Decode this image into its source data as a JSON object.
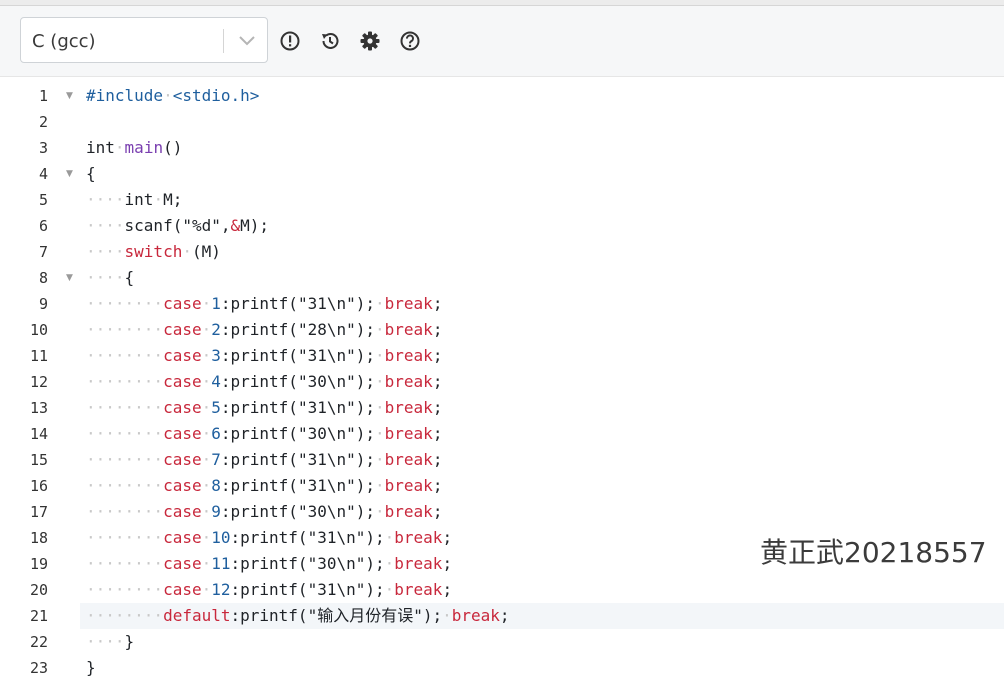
{
  "toolbar": {
    "language": "C (gcc)",
    "icons": [
      "alert-icon",
      "history-icon",
      "gear-icon",
      "help-icon"
    ]
  },
  "editor": {
    "active_line": 21,
    "lines": [
      {
        "n": "1",
        "fold": true,
        "tokens": [
          {
            "t": "#include",
            "c": "kw-blue"
          },
          {
            "t": "·",
            "c": "ws"
          },
          {
            "t": "<stdio.h>",
            "c": "kw-blue"
          }
        ]
      },
      {
        "n": "2",
        "fold": false,
        "tokens": []
      },
      {
        "n": "3",
        "fold": false,
        "tokens": [
          {
            "t": "int",
            "c": ""
          },
          {
            "t": "·",
            "c": "ws"
          },
          {
            "t": "main",
            "c": "kw-purple"
          },
          {
            "t": "()",
            "c": ""
          }
        ]
      },
      {
        "n": "4",
        "fold": true,
        "tokens": [
          {
            "t": "{",
            "c": ""
          }
        ]
      },
      {
        "n": "5",
        "fold": false,
        "tokens": [
          {
            "t": "····",
            "c": "ws"
          },
          {
            "t": "int",
            "c": ""
          },
          {
            "t": "·",
            "c": "ws"
          },
          {
            "t": "M;",
            "c": ""
          }
        ]
      },
      {
        "n": "6",
        "fold": false,
        "tokens": [
          {
            "t": "····",
            "c": "ws"
          },
          {
            "t": "scanf(\"%d\",",
            "c": ""
          },
          {
            "t": "&",
            "c": "kw-red"
          },
          {
            "t": "M);",
            "c": ""
          }
        ]
      },
      {
        "n": "7",
        "fold": false,
        "tokens": [
          {
            "t": "····",
            "c": "ws"
          },
          {
            "t": "switch",
            "c": "kw-red"
          },
          {
            "t": "·",
            "c": "ws"
          },
          {
            "t": "(M)",
            "c": ""
          }
        ]
      },
      {
        "n": "8",
        "fold": true,
        "tokens": [
          {
            "t": "····",
            "c": "ws"
          },
          {
            "t": "{",
            "c": ""
          }
        ]
      },
      {
        "n": "9",
        "fold": false,
        "tokens": [
          {
            "t": "········",
            "c": "ws"
          },
          {
            "t": "case",
            "c": "kw-red"
          },
          {
            "t": "·",
            "c": "ws"
          },
          {
            "t": "1",
            "c": "num"
          },
          {
            "t": ":printf(\"31\\n\");",
            "c": ""
          },
          {
            "t": "·",
            "c": "ws"
          },
          {
            "t": "break",
            "c": "kw-red"
          },
          {
            "t": ";",
            "c": ""
          }
        ]
      },
      {
        "n": "10",
        "fold": false,
        "tokens": [
          {
            "t": "········",
            "c": "ws"
          },
          {
            "t": "case",
            "c": "kw-red"
          },
          {
            "t": "·",
            "c": "ws"
          },
          {
            "t": "2",
            "c": "num"
          },
          {
            "t": ":printf(\"28\\n\");",
            "c": ""
          },
          {
            "t": "·",
            "c": "ws"
          },
          {
            "t": "break",
            "c": "kw-red"
          },
          {
            "t": ";",
            "c": ""
          }
        ]
      },
      {
        "n": "11",
        "fold": false,
        "tokens": [
          {
            "t": "········",
            "c": "ws"
          },
          {
            "t": "case",
            "c": "kw-red"
          },
          {
            "t": "·",
            "c": "ws"
          },
          {
            "t": "3",
            "c": "num"
          },
          {
            "t": ":printf(\"31\\n\");",
            "c": ""
          },
          {
            "t": "·",
            "c": "ws"
          },
          {
            "t": "break",
            "c": "kw-red"
          },
          {
            "t": ";",
            "c": ""
          }
        ]
      },
      {
        "n": "12",
        "fold": false,
        "tokens": [
          {
            "t": "········",
            "c": "ws"
          },
          {
            "t": "case",
            "c": "kw-red"
          },
          {
            "t": "·",
            "c": "ws"
          },
          {
            "t": "4",
            "c": "num"
          },
          {
            "t": ":printf(\"30\\n\");",
            "c": ""
          },
          {
            "t": "·",
            "c": "ws"
          },
          {
            "t": "break",
            "c": "kw-red"
          },
          {
            "t": ";",
            "c": ""
          }
        ]
      },
      {
        "n": "13",
        "fold": false,
        "tokens": [
          {
            "t": "········",
            "c": "ws"
          },
          {
            "t": "case",
            "c": "kw-red"
          },
          {
            "t": "·",
            "c": "ws"
          },
          {
            "t": "5",
            "c": "num"
          },
          {
            "t": ":printf(\"31\\n\");",
            "c": ""
          },
          {
            "t": "·",
            "c": "ws"
          },
          {
            "t": "break",
            "c": "kw-red"
          },
          {
            "t": ";",
            "c": ""
          }
        ]
      },
      {
        "n": "14",
        "fold": false,
        "tokens": [
          {
            "t": "········",
            "c": "ws"
          },
          {
            "t": "case",
            "c": "kw-red"
          },
          {
            "t": "·",
            "c": "ws"
          },
          {
            "t": "6",
            "c": "num"
          },
          {
            "t": ":printf(\"30\\n\");",
            "c": ""
          },
          {
            "t": "·",
            "c": "ws"
          },
          {
            "t": "break",
            "c": "kw-red"
          },
          {
            "t": ";",
            "c": ""
          }
        ]
      },
      {
        "n": "15",
        "fold": false,
        "tokens": [
          {
            "t": "········",
            "c": "ws"
          },
          {
            "t": "case",
            "c": "kw-red"
          },
          {
            "t": "·",
            "c": "ws"
          },
          {
            "t": "7",
            "c": "num"
          },
          {
            "t": ":printf(\"31\\n\");",
            "c": ""
          },
          {
            "t": "·",
            "c": "ws"
          },
          {
            "t": "break",
            "c": "kw-red"
          },
          {
            "t": ";",
            "c": ""
          }
        ]
      },
      {
        "n": "16",
        "fold": false,
        "tokens": [
          {
            "t": "········",
            "c": "ws"
          },
          {
            "t": "case",
            "c": "kw-red"
          },
          {
            "t": "·",
            "c": "ws"
          },
          {
            "t": "8",
            "c": "num"
          },
          {
            "t": ":printf(\"31\\n\");",
            "c": ""
          },
          {
            "t": "·",
            "c": "ws"
          },
          {
            "t": "break",
            "c": "kw-red"
          },
          {
            "t": ";",
            "c": ""
          }
        ]
      },
      {
        "n": "17",
        "fold": false,
        "tokens": [
          {
            "t": "········",
            "c": "ws"
          },
          {
            "t": "case",
            "c": "kw-red"
          },
          {
            "t": "·",
            "c": "ws"
          },
          {
            "t": "9",
            "c": "num"
          },
          {
            "t": ":printf(\"30\\n\");",
            "c": ""
          },
          {
            "t": "·",
            "c": "ws"
          },
          {
            "t": "break",
            "c": "kw-red"
          },
          {
            "t": ";",
            "c": ""
          }
        ]
      },
      {
        "n": "18",
        "fold": false,
        "tokens": [
          {
            "t": "········",
            "c": "ws"
          },
          {
            "t": "case",
            "c": "kw-red"
          },
          {
            "t": "·",
            "c": "ws"
          },
          {
            "t": "10",
            "c": "num"
          },
          {
            "t": ":printf(\"31\\n\");",
            "c": ""
          },
          {
            "t": "·",
            "c": "ws"
          },
          {
            "t": "break",
            "c": "kw-red"
          },
          {
            "t": ";",
            "c": ""
          }
        ]
      },
      {
        "n": "19",
        "fold": false,
        "tokens": [
          {
            "t": "········",
            "c": "ws"
          },
          {
            "t": "case",
            "c": "kw-red"
          },
          {
            "t": "·",
            "c": "ws"
          },
          {
            "t": "11",
            "c": "num"
          },
          {
            "t": ":printf(\"30\\n\");",
            "c": ""
          },
          {
            "t": "·",
            "c": "ws"
          },
          {
            "t": "break",
            "c": "kw-red"
          },
          {
            "t": ";",
            "c": ""
          }
        ]
      },
      {
        "n": "20",
        "fold": false,
        "tokens": [
          {
            "t": "········",
            "c": "ws"
          },
          {
            "t": "case",
            "c": "kw-red"
          },
          {
            "t": "·",
            "c": "ws"
          },
          {
            "t": "12",
            "c": "num"
          },
          {
            "t": ":printf(\"31\\n\");",
            "c": ""
          },
          {
            "t": "·",
            "c": "ws"
          },
          {
            "t": "break",
            "c": "kw-red"
          },
          {
            "t": ";",
            "c": ""
          }
        ]
      },
      {
        "n": "21",
        "fold": false,
        "tokens": [
          {
            "t": "········",
            "c": "ws"
          },
          {
            "t": "default",
            "c": "kw-red"
          },
          {
            "t": ":printf(\"输入月份有误\");",
            "c": ""
          },
          {
            "t": "·",
            "c": "ws"
          },
          {
            "t": "break",
            "c": "kw-red"
          },
          {
            "t": ";",
            "c": ""
          }
        ]
      },
      {
        "n": "22",
        "fold": false,
        "tokens": [
          {
            "t": "····",
            "c": "ws"
          },
          {
            "t": "}",
            "c": ""
          }
        ]
      },
      {
        "n": "23",
        "fold": false,
        "tokens": [
          {
            "t": "}",
            "c": ""
          }
        ]
      }
    ]
  },
  "watermark": "黄正武20218557"
}
